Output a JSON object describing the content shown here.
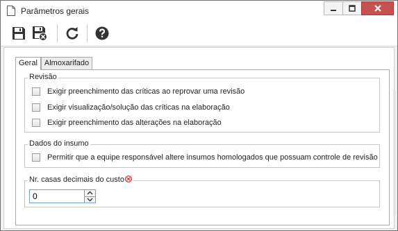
{
  "window": {
    "title": "Parâmetros gerais",
    "accent_close": "#c75050"
  },
  "toolbar": {
    "buttons": [
      {
        "icon": "save-icon"
      },
      {
        "icon": "save-and-close-icon"
      },
      {
        "icon": "refresh-icon"
      },
      {
        "icon": "help-icon"
      }
    ]
  },
  "tabs": [
    {
      "label": "Geral",
      "active": true
    },
    {
      "label": "Almoxarifado",
      "active": false
    }
  ],
  "revisao": {
    "legend": "Revisão",
    "options": [
      {
        "label": "Exigir preenchimento das críticas ao reprovar uma revisão",
        "checked": false
      },
      {
        "label": "Exigir visualização/solução das críticas na elaboração",
        "checked": false
      },
      {
        "label": "Exigir preenchimento das alterações na elaboração",
        "checked": false
      }
    ]
  },
  "dados_insumo": {
    "legend": "Dados do insumo",
    "options": [
      {
        "label": "Permitir que a equipe responsável altere insumos homologados que possuam controle de revisão",
        "checked": false
      }
    ]
  },
  "decimais": {
    "legend": "Nr. casas decimais do custo",
    "required": true,
    "value": "0"
  }
}
